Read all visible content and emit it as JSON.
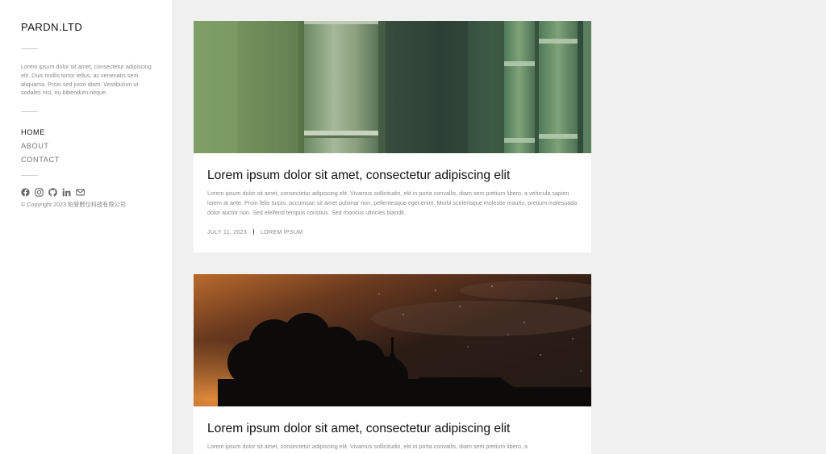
{
  "sidebar": {
    "brand": "PARDN.LTD",
    "description": "Lorem ipsum dolor sit amet, consectetur adipiscing elit. Duis mollis tortor tellus, ac venenatis sem aliquama. Proin sed justo diam. Vestibulum ut sodales nisl, eu bibendum neque.",
    "nav": [
      {
        "label": "HOME",
        "active": true
      },
      {
        "label": "ABOUT",
        "active": false
      },
      {
        "label": "CONTACT",
        "active": false
      }
    ],
    "socials": [
      "facebook-icon",
      "instagram-icon",
      "github-icon",
      "linkedin-icon",
      "mail-icon"
    ],
    "copyright": "© Copyright 2023 帕登數位科技有限公司"
  },
  "posts": [
    {
      "image": "bamboo-photo",
      "title": "Lorem ipsum dolor sit amet, consectetur adipiscing elit",
      "excerpt": "Lorem ipsum dolor sit amet, consectetur adipiscing elit. Vivamus sollicitudin, elit in porta convallis, diam sem pretium libero, a vehicula sapien lorem at ante. Proin felis turpis, accumsan sit amet pulvinar non, pellentesque eget enim. Morbi scelerisque molestie mauris, pretium malesuada dolor auctor non. Sed eleifend tempus constius. Sed rhoncus ultricies blandit.",
      "date": "JULY 11, 2023",
      "category": "LOREM IPSUM"
    },
    {
      "image": "night-sky-tree-photo",
      "title": "Lorem ipsum dolor sit amet, consectetur adipiscing elit",
      "excerpt": "Lorem ipsum dolor sit amet, consectetur adipiscing elit. Vivamus sollicitudin, elit in porta convallis, diam sem pretium libero, a"
    }
  ],
  "colors": {
    "page_bg": "#f0f0f0",
    "panel_bg": "#ffffff",
    "text_dark": "#111111",
    "text_muted": "#8a8a8a"
  }
}
